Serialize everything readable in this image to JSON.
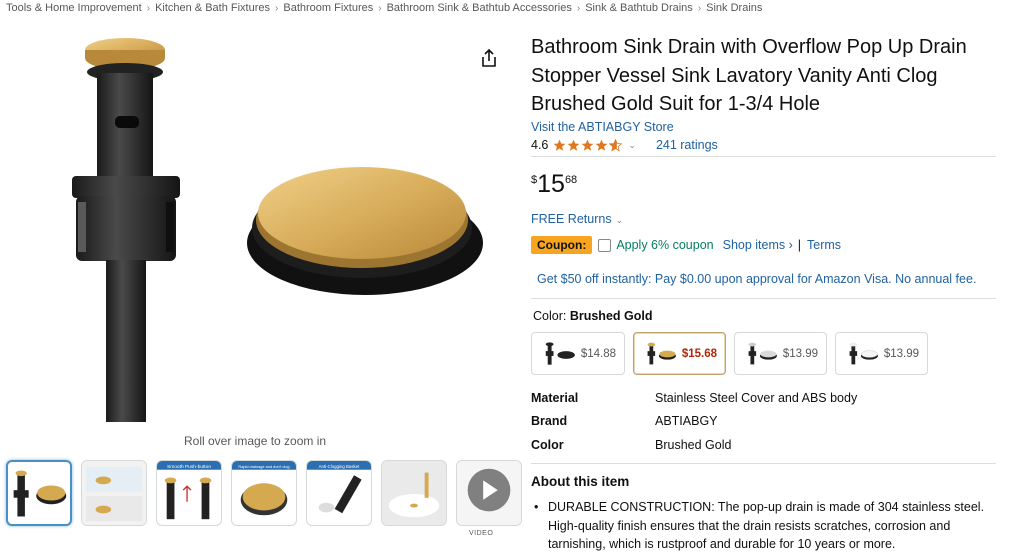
{
  "breadcrumb": [
    "Tools & Home Improvement",
    "Kitchen & Bath Fixtures",
    "Bathroom Fixtures",
    "Bathroom Sink & Bathtub Accessories",
    "Sink & Bathtub Drains",
    "Sink Drains"
  ],
  "breadcrumb_sep": "›",
  "gallery": {
    "zoom_hint": "Roll over image to zoom in",
    "thumb_labels": [
      "Smooth Push-button",
      "Rapid drainage and don't clog",
      "Anti-Clogging Basket"
    ],
    "video_label": "VIDEO"
  },
  "product": {
    "title": "Bathroom Sink Drain with Overflow Pop Up Drain Stopper Vessel Sink Lavatory Vanity Anti Clog Brushed Gold Suit for 1-3/4 Hole",
    "store": "Visit the ABTIABGY Store",
    "rating": "4.6",
    "rating_chevron": "⌄",
    "ratings_count": "241 ratings",
    "star_color": "#de7921"
  },
  "price": {
    "symbol": "$",
    "whole": "15",
    "fraction": "68"
  },
  "returns": {
    "label": "FREE Returns",
    "chevron": "⌄"
  },
  "coupon": {
    "badge": "Coupon:",
    "text": "Apply 6% coupon",
    "shop": "Shop items ›",
    "sep": "|",
    "terms": "Terms"
  },
  "offer": "Get $50 off instantly: Pay $0.00 upon approval for Amazon Visa. No annual fee.",
  "color": {
    "label": "Color: ",
    "selected": "Brushed Gold"
  },
  "swatches": [
    {
      "price": "$14.88",
      "cap": "#1f1f1f"
    },
    {
      "price": "$15.68",
      "cap": "#d4a94f"
    },
    {
      "price": "$13.99",
      "cap": "#d9d9d9"
    },
    {
      "price": "$13.99",
      "cap": "#f5f5f5"
    }
  ],
  "specs": [
    {
      "key": "Material",
      "value": "Stainless Steel Cover and ABS body"
    },
    {
      "key": "Brand",
      "value": "ABTIABGY"
    },
    {
      "key": "Color",
      "value": "Brushed Gold"
    }
  ],
  "about": {
    "title": "About this item",
    "items": [
      "DURABLE CONSTRUCTION: The pop-up drain is made of 304 stainless steel. High-quality finish ensures that the drain resists scratches, corrosion and tarnishing, which is rustproof and durable for 10 years or more."
    ]
  },
  "colors": {
    "link": "#2162a1",
    "gold": "#d4a94f",
    "coupon": "#f7a521",
    "price_red": "#b12704",
    "green": "#067d62"
  }
}
